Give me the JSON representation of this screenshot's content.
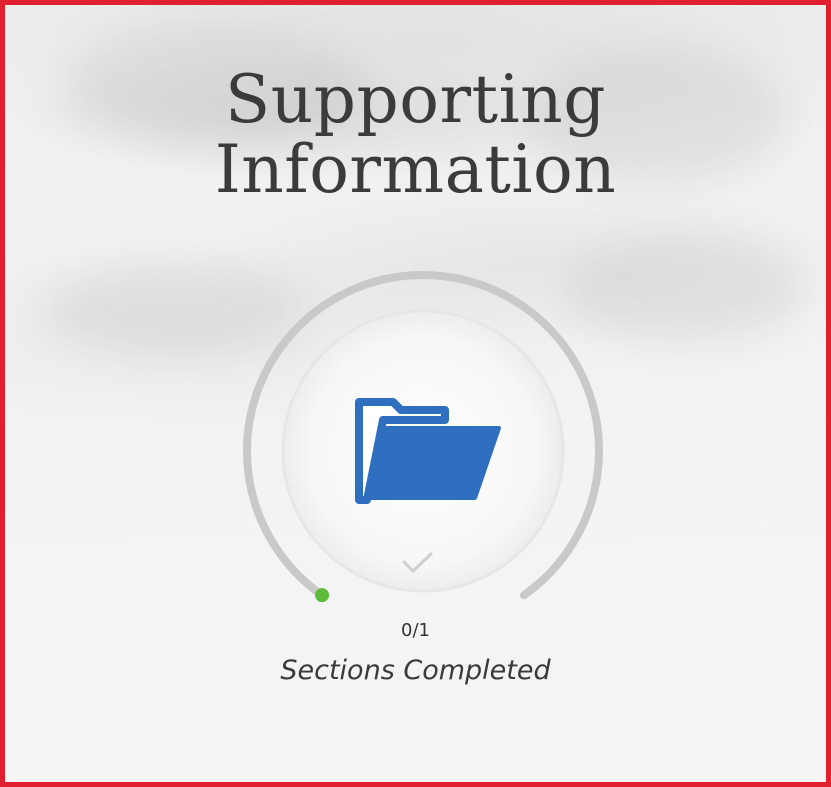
{
  "card": {
    "title_line1": "Supporting",
    "title_line2": "Information",
    "icon": "folder-open-icon",
    "status_icon": "checkmark-icon",
    "completed": 0,
    "total": 1,
    "progress_fraction": 0,
    "count_text": "0/1",
    "caption": "Sections Completed"
  },
  "colors": {
    "frame_border": "#e0202f",
    "folder_blue": "#2f6fbf",
    "progress_dot": "#5dbb3a",
    "ring_track": "#c9c9c9",
    "title_text": "#3b3b3b"
  }
}
